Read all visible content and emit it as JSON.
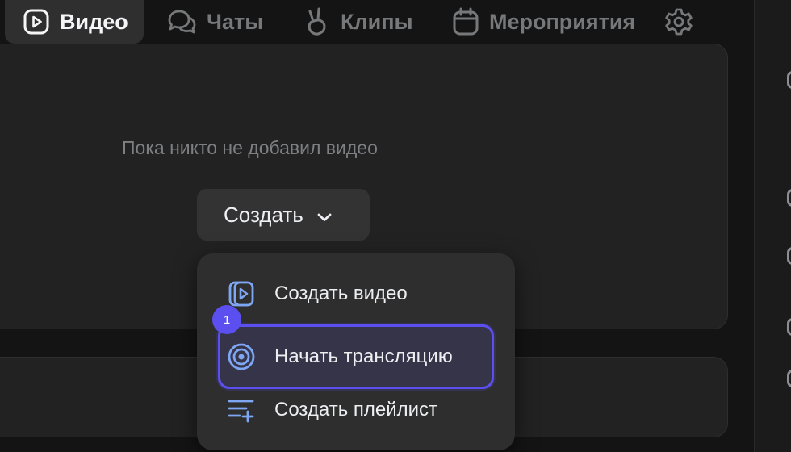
{
  "tabs": {
    "video": "Видео",
    "chats": "Чаты",
    "clips": "Клипы",
    "events": "Мероприятия"
  },
  "empty_state": {
    "message": "Пока никто не добавил видео"
  },
  "create_button": {
    "label": "Создать"
  },
  "menu": {
    "items": [
      {
        "label": "Создать видео",
        "icon": "video-stack-icon"
      },
      {
        "label": "Начать трансляцию",
        "icon": "broadcast-icon"
      },
      {
        "label": "Создать плейлист",
        "icon": "playlist-add-icon"
      }
    ]
  },
  "step_badge": {
    "number": "1"
  },
  "colors": {
    "background": "#141414",
    "panel": "#222222",
    "active_tab": "#2f2f2f",
    "dropdown": "#2e2e2e",
    "accent": "#5b4ff0",
    "icon_accent": "#7ea6f3",
    "muted_text": "#76787a"
  }
}
